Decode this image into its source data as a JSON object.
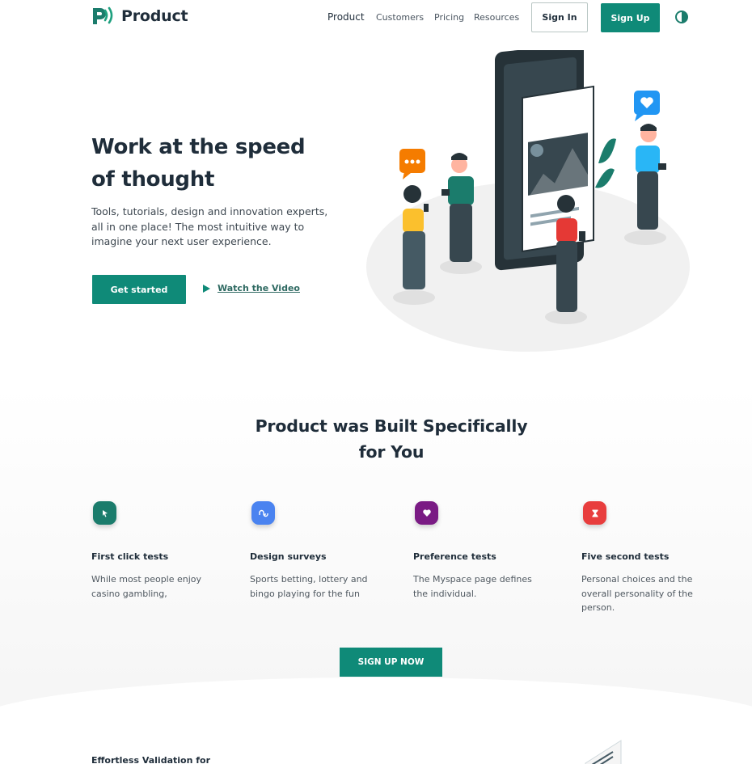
{
  "brand": {
    "name": "Product",
    "accent": "#0f8a78"
  },
  "nav": {
    "items": [
      {
        "label": "Product",
        "active": true
      },
      {
        "label": "Customers",
        "active": false
      },
      {
        "label": "Pricing",
        "active": false
      },
      {
        "label": "Resources",
        "active": false
      }
    ],
    "signin_label": "Sign In",
    "signup_label": "Sign Up",
    "theme_toggle_icon": "contrast-icon"
  },
  "hero": {
    "title_line1": "Work at the speed",
    "title_line2": "of thought",
    "description": "Tools, tutorials, design and innovation experts, all in one place! The most intuitive way to imagine your next user experience.",
    "cta_label": "Get started",
    "video_label": "Watch the Video"
  },
  "features": {
    "title_line1": "Product was Built Specifically",
    "title_line2": "for You",
    "items": [
      {
        "title": "First click tests",
        "description": "While most people enjoy casino gambling,",
        "icon": "cursor-icon",
        "color": "#1b7c6c"
      },
      {
        "title": "Design surveys",
        "description": "Sports betting, lottery and bingo playing for the fun",
        "icon": "stumbleupon-icon",
        "color": "#4a83f0"
      },
      {
        "title": "Preference tests",
        "description": "The Myspace page defines the individual.",
        "icon": "heart-icon",
        "color": "#7a1b84"
      },
      {
        "title": "Five second tests",
        "description": "Personal choices and the overall personality of the person.",
        "icon": "hourglass-icon",
        "color": "#e83d3d"
      }
    ],
    "cta_label": "SIGN UP NOW"
  },
  "teaser": {
    "title": "Effortless Validation for"
  }
}
